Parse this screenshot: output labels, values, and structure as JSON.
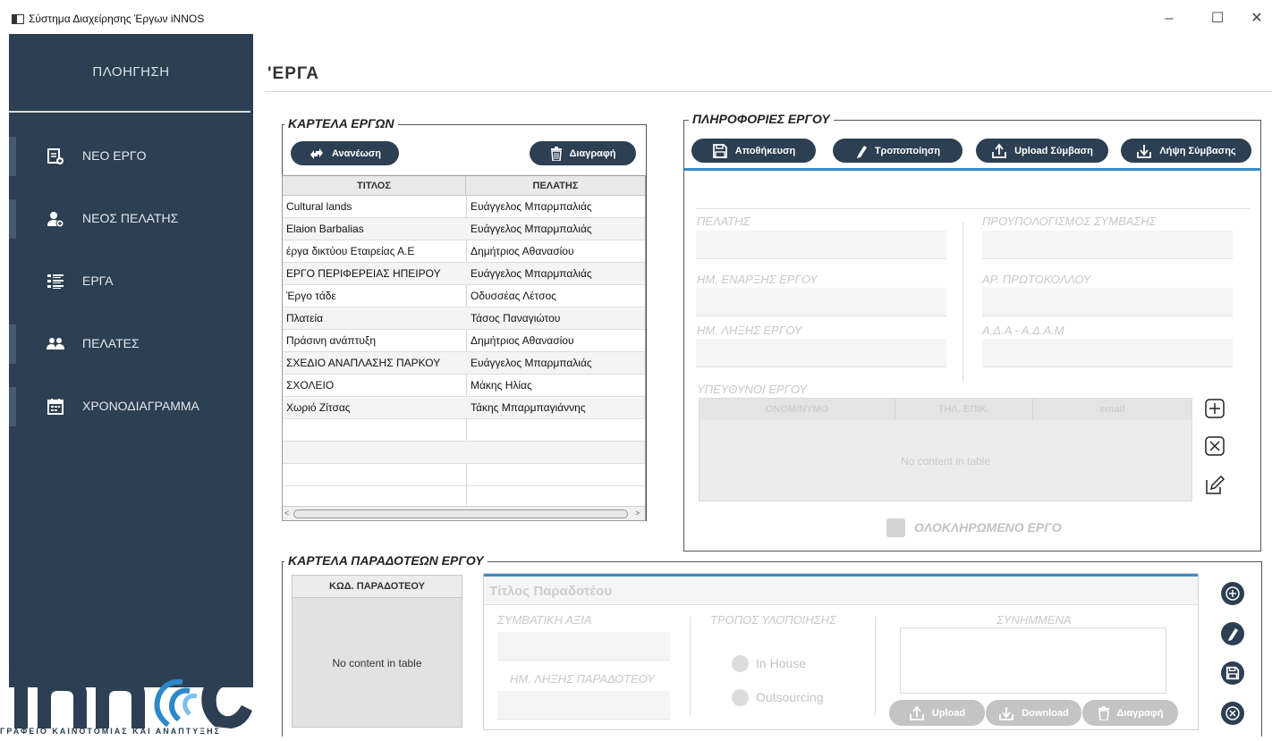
{
  "window": {
    "title": "Σύστημα Διαχείρησης Έργων iNNOS",
    "controls": {
      "minimize": "–",
      "maximize": "☐",
      "close": "✕"
    }
  },
  "sidebar": {
    "heading": "ΠΛΟΗΓΗΣΗ",
    "items": [
      {
        "label": "ΝΕΟ ΕΡΓΟ",
        "icon": "new-project-icon"
      },
      {
        "label": "ΝΕΟΣ ΠΕΛΑΤΗΣ",
        "icon": "add-user-icon"
      },
      {
        "label": "ΕΡΓΑ",
        "icon": "list-icon"
      },
      {
        "label": "ΠΕΛΑΤΕΣ",
        "icon": "users-icon"
      },
      {
        "label": "ΧΡΟΝΟΔΙΑΓΡΑΜΜΑ",
        "icon": "calendar-icon"
      }
    ],
    "logo_text": "iNNOS",
    "logo_tagline": "ΓΡΑΦΕΙΟ ΚΑΙΝΟΤΟΜΙΑΣ ΚΑΙ ΑΝΑΠΤΥΞΗΣ"
  },
  "page": {
    "title": "'ΕΡΓΑ"
  },
  "projects_panel": {
    "legend": "ΚΑΡΤΕΛΑ ΕΡΓΩΝ",
    "refresh_label": "Ανανέωση",
    "delete_label": "Διαγραφή",
    "columns": [
      "ΤΙΤΛΟΣ",
      "ΠΕΛΑΤΗΣ"
    ],
    "rows": [
      [
        "Cultural lands",
        "Ευάγγελος Μπαρμπαλιάς"
      ],
      [
        "Elaion Barbalias",
        "Ευάγγελος Μπαρμπαλιάς"
      ],
      [
        "έργα δικτύου Εταιρείας Α.Ε",
        "Δημήτριος Αθανασίου"
      ],
      [
        "ΕΡΓΟ ΠΕΡΙΦΕΡΕΙΑΣ ΗΠΕΙΡΟΥ",
        "Ευάγγελος Μπαρμπαλιάς"
      ],
      [
        "Έργο τάδε",
        "Οδυσσέας Λέτσος"
      ],
      [
        "Πλατεία",
        "Τάσος Παναγιώτου"
      ],
      [
        "Πράσινη ανάπτυξη",
        "Δημήτριος Αθανασίου"
      ],
      [
        "ΣΧΕΔΙΟ ΑΝΑΠΛΑΣΗΣ ΠΑΡΚΟΥ",
        "Ευάγγελος Μπαρμπαλιάς"
      ],
      [
        "ΣΧΟΛΕΙΟ",
        "Μάκης Ηλίας"
      ],
      [
        "Χωριό Ζίτσας",
        "Τάκης Μπαρμπαγιάννης"
      ]
    ]
  },
  "info_panel": {
    "legend": "ΠΛΗΡΟΦΟΡΙΕΣ ΕΡΓΟΥ",
    "buttons": {
      "save": "Αποθήκευση",
      "modify": "Τροποποίηση",
      "upload": "Upload Σύμβαση",
      "download": "Λήψη Σύμβασης"
    },
    "fields": {
      "client": "ΠΕΛΑΤΗΣ",
      "budget": "ΠΡΟΥΠΟΛΟΓΙΣΜΟΣ ΣΥΜΒΑΣΗΣ",
      "start_date": "ΗΜ. ΕΝΑΡΞΗΣ ΕΡΓΟΥ",
      "protocol": "ΑΡ. ΠΡΩΤΟΚΟΛΛΟΥ",
      "end_date": "ΗΜ. ΛΗΞΗΣ ΕΡΓΟΥ",
      "ada": "Α.Δ.Α - Α.Δ.Α.Μ"
    },
    "responsible": {
      "label": "ΥΠΕΥΘΥΝΟΙ ΕΡΓΟΥ",
      "columns": [
        "ΟΝΟΜ/ΝΥΜΟ",
        "ΤΗΛ. ΕΠΙΚ.",
        "email"
      ],
      "empty": "No content in table"
    },
    "completed_label": "ΟΛΟΚΛΗΡΩΜΕΝΟ ΕΡΓΟ"
  },
  "deliverables_panel": {
    "legend": "ΚΑΡΤΕΛΑ ΠΑΡΑΔΟΤΕΩΝ ΕΡΓΟΥ",
    "code_column": "ΚΩΔ. ΠΑΡΑΔΟΤΕΟΥ",
    "empty": "No content in table",
    "form": {
      "title_placeholder": "Τίτλος Παραδοτέου",
      "value_label": "ΣΥΜΒΑΤΙΚΗ ΑΞΙΑ",
      "end_label": "ΗΜ. ΛΗΞΗΣ ΠΑΡΑΔΟΤΕΟΥ",
      "method_label": "ΤΡΟΠΟΣ ΥΛΟΠΟΙΗΣΗΣ",
      "in_house": "In House",
      "outsourcing": "Outsourcing",
      "attachments_label": "ΣΥΝΗΜΜΕΝΑ",
      "upload": "Upload",
      "download": "Download",
      "delete": "Διαγραφή"
    }
  }
}
